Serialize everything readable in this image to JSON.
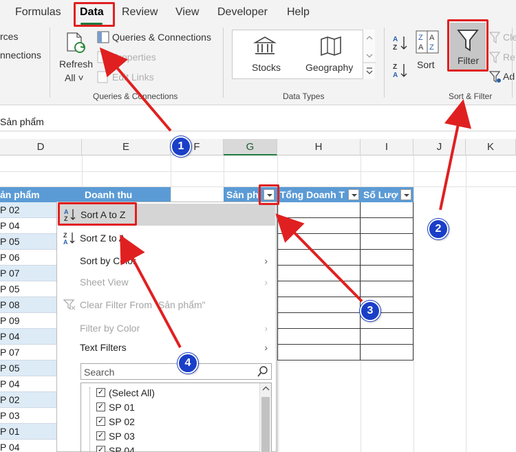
{
  "tabs": [
    {
      "label": "Formulas"
    },
    {
      "label": "Data"
    },
    {
      "label": "Review"
    },
    {
      "label": "View"
    },
    {
      "label": "Developer"
    },
    {
      "label": "Help"
    }
  ],
  "ribbon": {
    "left_partial_1": "rces",
    "left_partial_2": "nnections",
    "refresh_label_1": "Refresh",
    "refresh_label_2": "All ˅",
    "queries_connections": "Queries & Connections",
    "properties": "Properties",
    "edit_links": "Edit Links",
    "group_queries": "Queries & Connections",
    "stocks": "Stocks",
    "geography": "Geography",
    "group_datatypes": "Data Types",
    "sort": "Sort",
    "filter": "Filter",
    "clear_partial": "Cle",
    "reapply_partial": "Re",
    "advanced_partial": "Ad",
    "group_sortfilter": "Sort & Filter"
  },
  "formula_bar": {
    "value": "Sản phẩm"
  },
  "columns": [
    {
      "label": "D"
    },
    {
      "label": "E"
    },
    {
      "label": "F"
    },
    {
      "label": "G"
    },
    {
      "label": "H"
    },
    {
      "label": "I"
    },
    {
      "label": "J"
    },
    {
      "label": "K"
    }
  ],
  "table_headers": {
    "d": "ản phẩm",
    "e": "Doanh thu",
    "g": "Sản ph",
    "h": "Tổng Doanh T",
    "i": "Số Lượ"
  },
  "rows": [
    "P 02",
    "P 04",
    "P 05",
    "P 06",
    "P 07",
    "P 05",
    "P 08",
    "P 09",
    "P 04",
    "P 07",
    "P 05",
    "P 04",
    "P 02",
    "P 03",
    "P 01",
    "P 04"
  ],
  "menu": {
    "sort_az": "Sort A to Z",
    "sort_za": "Sort Z to A",
    "sort_by_color": "Sort by Color",
    "sheet_view": "Sheet View",
    "clear_filter": "Clear Filter From \"Sản phẩm\"",
    "filter_by_color": "Filter by Color",
    "text_filters": "Text Filters",
    "search_placeholder": "Search",
    "list": [
      "(Select All)",
      "SP 01",
      "SP 02",
      "SP 03",
      "SP 04"
    ]
  },
  "badges": [
    "1",
    "2",
    "3",
    "4"
  ],
  "colors": {
    "annotation_red": "#e02020",
    "badge_blue": "#1a3fc7",
    "table_header_blue": "#5b9bd5",
    "row_band": "#ddebf7",
    "excel_green": "#1d7a3f"
  }
}
